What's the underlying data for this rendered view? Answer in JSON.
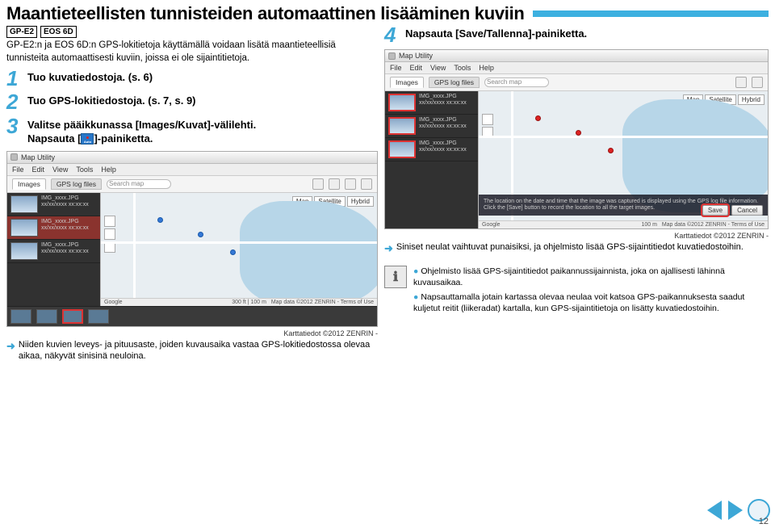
{
  "title": "Maantieteellisten tunnisteiden automaattinen lisääminen kuviin",
  "badges": [
    "GP-E2",
    "EOS 6D"
  ],
  "intro": "GP-E2:n ja EOS 6D:n GPS-lokitietoja käyttämällä voidaan lisätä maantieteellisiä tunnisteita automaattisesti kuviin, joissa ei ole sijaintitietoja.",
  "steps": {
    "s1": {
      "n": "1",
      "text": "Tuo kuvatiedostoja. (s. 6)"
    },
    "s2": {
      "n": "2",
      "text": "Tuo GPS-lokitiedostoja. (s. 7, s. 9)"
    },
    "s3": {
      "n": "3",
      "line1": "Valitse pääikkunassa [Images/Kuvat]-välilehti.",
      "line2a": "Napsauta [",
      "line2b": "]-painiketta."
    },
    "s4": {
      "n": "4",
      "text": "Napsauta [Save/Tallenna]-painiketta."
    }
  },
  "app": {
    "title": "Map Utility",
    "menus": [
      "File",
      "Edit",
      "View",
      "Tools",
      "Help"
    ],
    "tabs": {
      "images": "Images",
      "gps": "GPS log files"
    },
    "search_placeholder": "Search map",
    "map_tabs": [
      "Map",
      "Satellite",
      "Hybrid"
    ],
    "items": [
      {
        "name": "IMG_xxxx.JPG",
        "date": "xx/xx/xxxx xx:xx:xx"
      },
      {
        "name": "IMG_xxxx.JPG",
        "date": "xx/xx/xxxx xx:xx:xx"
      },
      {
        "name": "IMG_xxxx.JPG",
        "date": "xx/xx/xxxx xx:xx:xx"
      }
    ],
    "darkbar_text": "The location on the date and time that the image was captured is displayed using the GPS log file information. Click the [Save] button to record the location to all the target images.",
    "save": "Save",
    "cancel": "Cancel",
    "scale1": "300 ft",
    "scale2": "100 m",
    "attrib_right": "Map data ©2012 ZENRIN - Terms of Use",
    "glogo": "Google"
  },
  "attrib": "Karttatiedot ©2012 ZENRIN -",
  "note_left": "Niiden kuvien leveys- ja pituusaste, joiden kuvausaika vastaa GPS-lokitiedostossa olevaa aikaa, näkyvät sinisinä neuloina.",
  "note_right": "Siniset neulat vaihtuvat punaisiksi, ja ohjelmisto lisää GPS-sijaintitiedot kuvatiedostoihin.",
  "info": {
    "line1": "Ohjelmisto lisää GPS-sijaintitiedot paikannussijainnista, joka on ajallisesti lähinnä kuvausaikaa.",
    "line2": "Napsauttamalla jotain kartassa olevaa neulaa voit katsoa GPS-paikannuksesta saadut kuljetut reitit (liikeradat) kartalla, kun GPS-sijaintitietoja on lisätty kuvatiedostoihin."
  },
  "page_number": "12"
}
